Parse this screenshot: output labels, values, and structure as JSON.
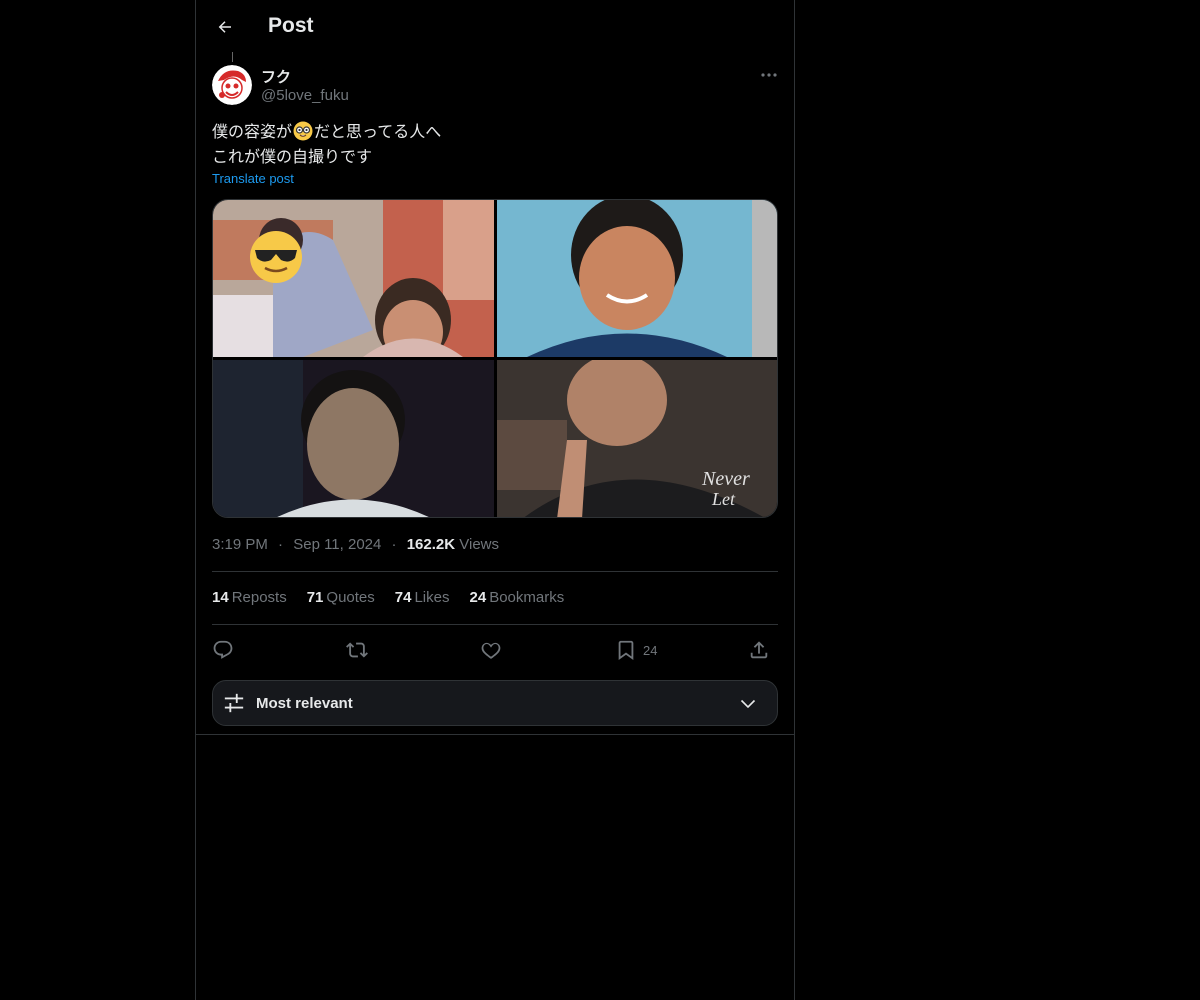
{
  "header": {
    "title": "Post",
    "back_icon": "arrow-left-icon"
  },
  "post": {
    "author": {
      "display_name": "フク",
      "handle": "@5love_fuku",
      "avatar_icon": "avatar-icon"
    },
    "text_line1_a": "僕の容姿が",
    "text_emoji": "nerd-face-emoji",
    "text_line1_b": "だと思ってる人へ",
    "text_line2": "これが僕の自撮りです",
    "translate_label": "Translate post",
    "media": [
      {
        "alt": "photo-1",
        "icon": "sunglasses-emoji"
      },
      {
        "alt": "photo-2"
      },
      {
        "alt": "photo-3"
      },
      {
        "alt": "photo-4"
      }
    ],
    "time": "3:19 PM",
    "date": "Sep 11, 2024",
    "views_count": "162.2K",
    "views_label": "Views",
    "dot": "·"
  },
  "stats": {
    "reposts_count": "14",
    "reposts_label": "Reposts",
    "quotes_count": "71",
    "quotes_label": "Quotes",
    "likes_count": "74",
    "likes_label": "Likes",
    "bookmarks_count": "24",
    "bookmarks_label": "Bookmarks"
  },
  "actions": {
    "reply_icon": "reply-icon",
    "repost_icon": "repost-icon",
    "like_icon": "heart-icon",
    "bookmark_icon": "bookmark-icon",
    "bookmark_count": "24",
    "share_icon": "share-icon"
  },
  "replies_sort": {
    "label": "Most relevant",
    "icon": "sliders-icon",
    "chevron": "chevron-down-icon"
  },
  "colors": {
    "background": "#000000",
    "text": "#e7e9ea",
    "muted": "#71767b",
    "link": "#1d9bf0",
    "border": "#2f3336"
  }
}
